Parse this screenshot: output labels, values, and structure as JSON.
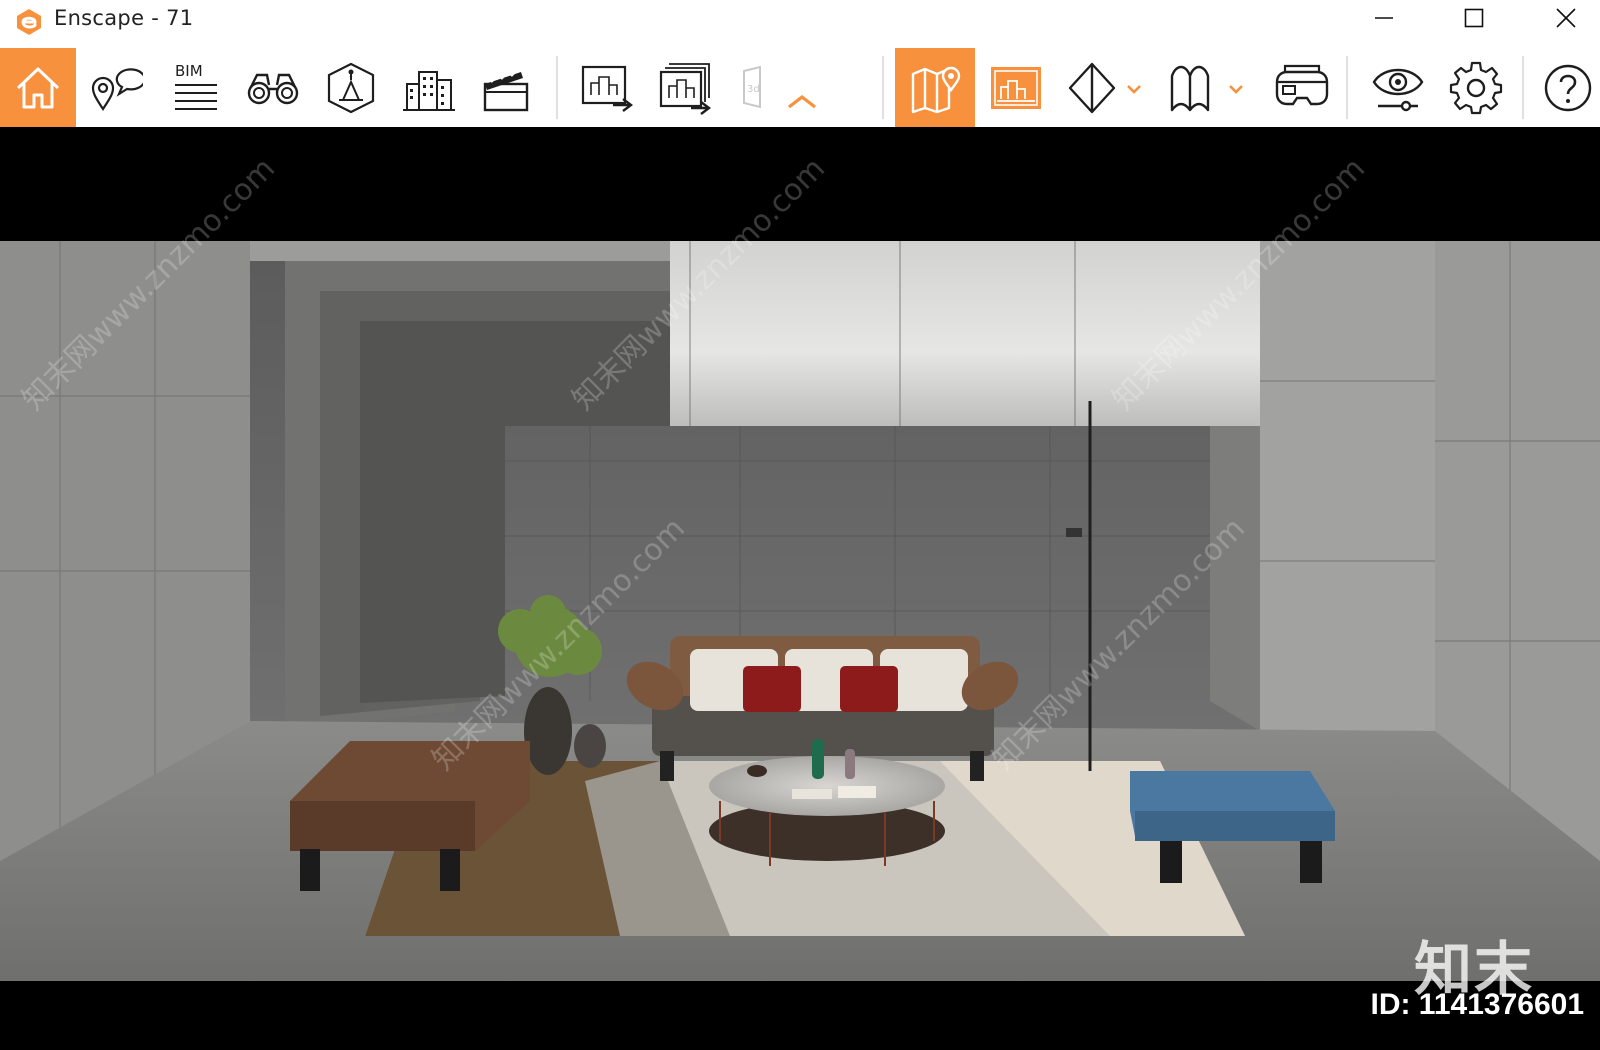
{
  "window": {
    "app_name": "Enscape",
    "title": "Enscape - 71",
    "brand_color": "#f7913d",
    "controls": [
      "minimize-icon",
      "maximize-icon",
      "close-icon"
    ]
  },
  "toolbar": {
    "bim_label": "BIM",
    "tools": [
      {
        "name": "home",
        "icon": "home-icon",
        "active": true
      },
      {
        "name": "views",
        "icon": "location-chat-icon"
      },
      {
        "name": "bim-info",
        "icon": "bim-icon"
      },
      {
        "name": "binoculars",
        "icon": "binoculars-icon"
      },
      {
        "name": "asset-library",
        "icon": "asset-cube-icon"
      },
      {
        "name": "buildings",
        "icon": "buildings-icon"
      },
      {
        "name": "video-editor",
        "icon": "clapperboard-icon"
      },
      {
        "name": "export-image",
        "icon": "export-image-icon"
      },
      {
        "name": "batch-export",
        "icon": "batch-export-icon"
      },
      {
        "name": "export-3d",
        "icon": "export-3d-icon",
        "disabled": true
      },
      {
        "name": "collapse",
        "icon": "chevron-up-icon"
      },
      {
        "name": "map",
        "icon": "map-icon",
        "active": true
      },
      {
        "name": "minimap",
        "icon": "minimap-icon"
      },
      {
        "name": "section",
        "icon": "diamond-section-icon",
        "dropdown": true
      },
      {
        "name": "panorama",
        "icon": "panorama-icon",
        "dropdown": true
      },
      {
        "name": "vr-headset",
        "icon": "vr-headset-icon"
      },
      {
        "name": "visual-settings",
        "icon": "eye-slider-icon"
      },
      {
        "name": "settings",
        "icon": "gear-icon"
      },
      {
        "name": "help",
        "icon": "help-icon"
      }
    ]
  },
  "viewport": {
    "watermark_text": "知末网www.znzmo.com",
    "watermark_logo": "知末",
    "watermark_id": "ID: 1141376601"
  }
}
